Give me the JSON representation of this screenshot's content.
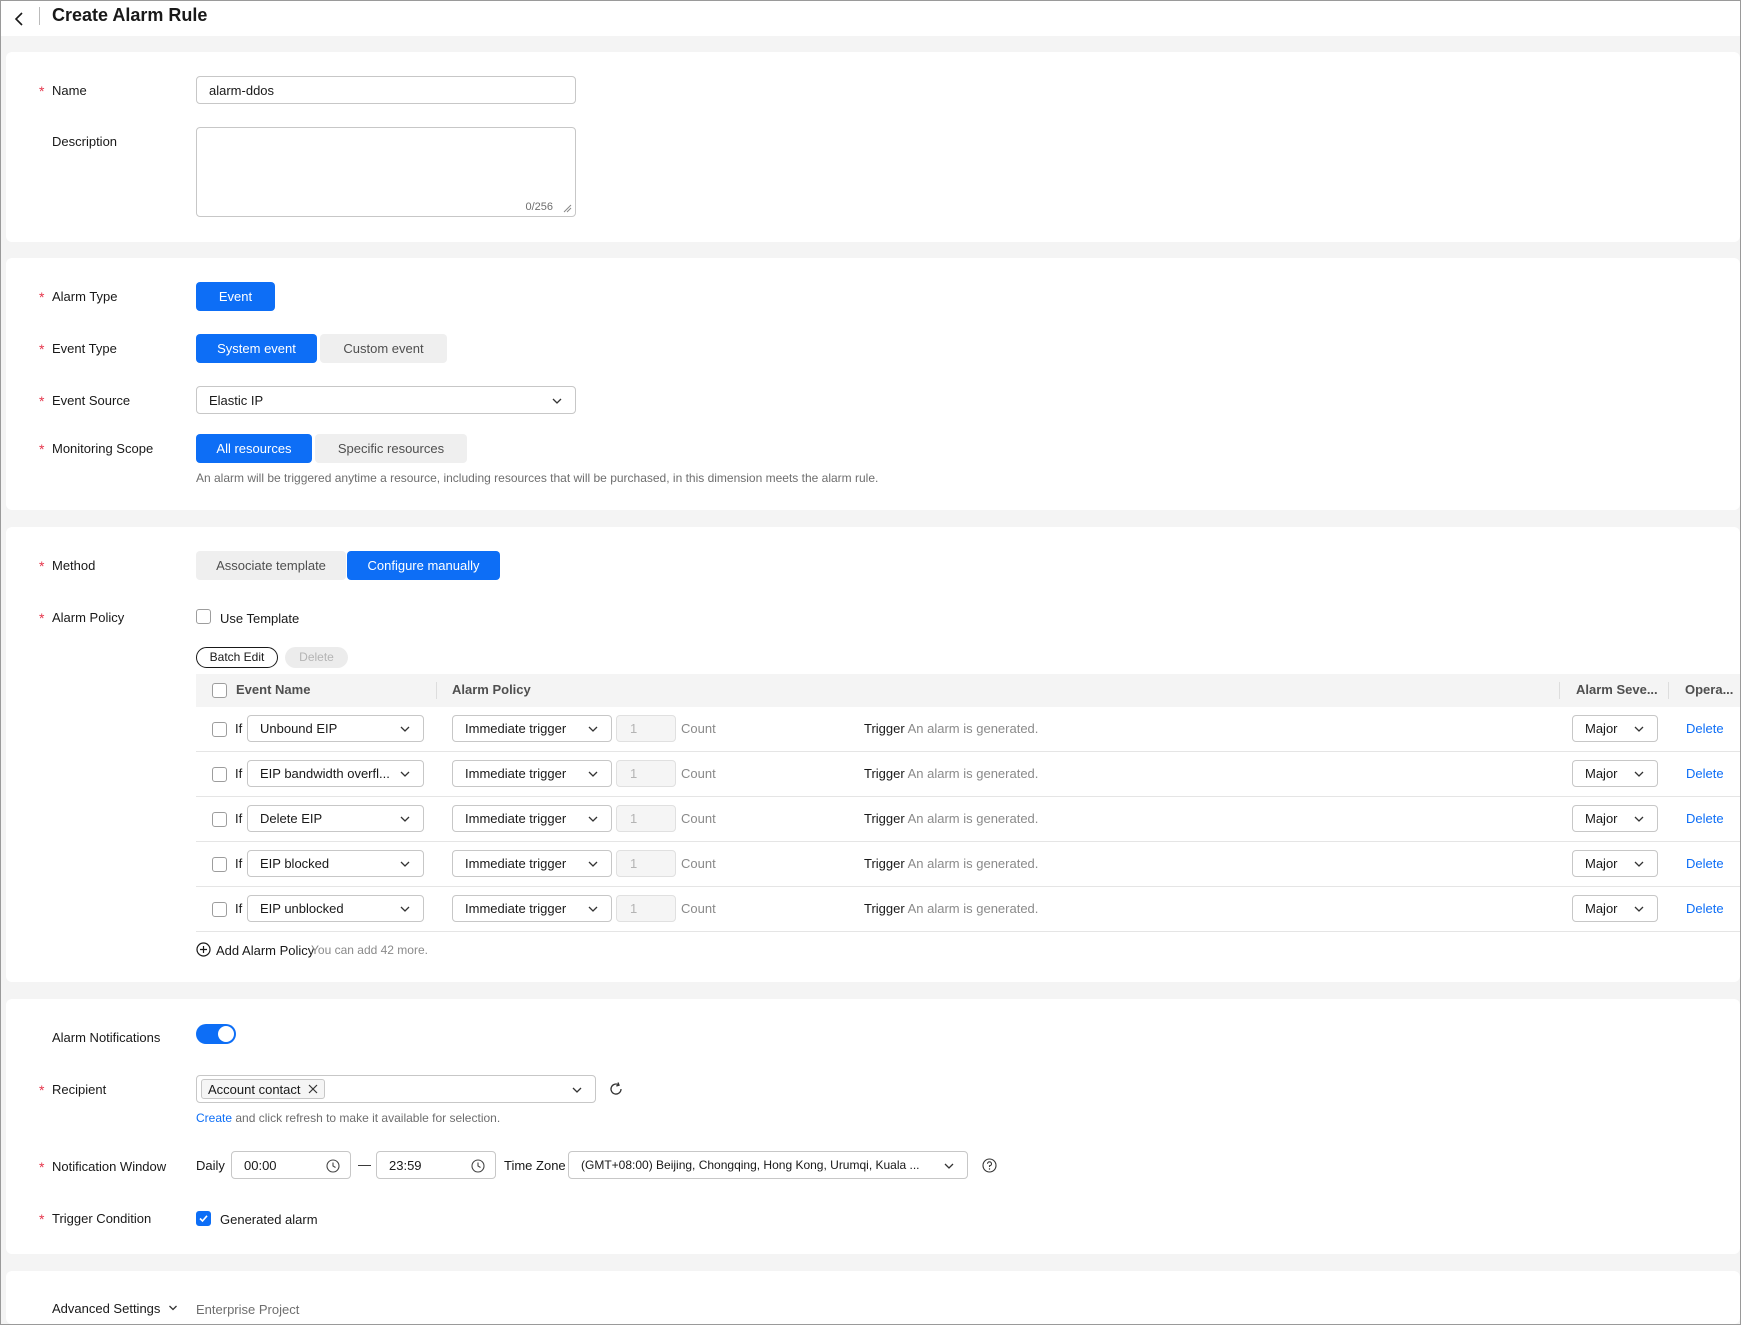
{
  "header": {
    "title": "Create Alarm Rule"
  },
  "basic": {
    "name_label": "Name",
    "name_value": "alarm-ddos",
    "description_label": "Description",
    "description_counter": "0/256"
  },
  "alarm": {
    "alarm_type_label": "Alarm Type",
    "alarm_type_option": "Event",
    "event_type_label": "Event Type",
    "event_type_options": [
      "System event",
      "Custom event"
    ],
    "event_source_label": "Event Source",
    "event_source_value": "Elastic IP",
    "scope_label": "Monitoring Scope",
    "scope_options": [
      "All resources",
      "Specific resources"
    ],
    "scope_hint": "An alarm will be triggered anytime a resource, including resources that will be purchased, in this dimension meets the alarm rule."
  },
  "policy": {
    "method_label": "Method",
    "method_options": [
      "Associate template",
      "Configure manually"
    ],
    "alarm_policy_label": "Alarm Policy",
    "use_template_label": "Use Template",
    "batch_edit_label": "Batch Edit",
    "delete_label": "Delete",
    "columns": [
      "Event Name",
      "Alarm Policy",
      "Alarm Seve...",
      "Opera..."
    ],
    "rows": [
      {
        "if": "If",
        "event": "Unbound EIP",
        "trigger": "Immediate trigger",
        "count": "1",
        "count_label": "Count",
        "trigger_word": "Trigger",
        "trigger_text": "An alarm is generated.",
        "severity": "Major",
        "action": "Delete"
      },
      {
        "if": "If",
        "event": "EIP bandwidth overfl...",
        "trigger": "Immediate trigger",
        "count": "1",
        "count_label": "Count",
        "trigger_word": "Trigger",
        "trigger_text": "An alarm is generated.",
        "severity": "Major",
        "action": "Delete"
      },
      {
        "if": "If",
        "event": "Delete EIP",
        "trigger": "Immediate trigger",
        "count": "1",
        "count_label": "Count",
        "trigger_word": "Trigger",
        "trigger_text": "An alarm is generated.",
        "severity": "Major",
        "action": "Delete"
      },
      {
        "if": "If",
        "event": "EIP blocked",
        "trigger": "Immediate trigger",
        "count": "1",
        "count_label": "Count",
        "trigger_word": "Trigger",
        "trigger_text": "An alarm is generated.",
        "severity": "Major",
        "action": "Delete"
      },
      {
        "if": "If",
        "event": "EIP unblocked",
        "trigger": "Immediate trigger",
        "count": "1",
        "count_label": "Count",
        "trigger_word": "Trigger",
        "trigger_text": "An alarm is generated.",
        "severity": "Major",
        "action": "Delete"
      }
    ],
    "add_policy_label": "Add Alarm Policy",
    "add_policy_hint": "You can add 42 more."
  },
  "notify": {
    "notifications_label": "Alarm Notifications",
    "notifications_on": true,
    "recipient_label": "Recipient",
    "recipient_tag": "Account contact",
    "create_link": "Create",
    "create_hint": "and click refresh to make it available for selection.",
    "window_label": "Notification Window",
    "daily_label": "Daily",
    "start_time": "00:00",
    "dash": "—",
    "end_time": "23:59",
    "timezone_label": "Time Zone",
    "timezone_value": "(GMT+08:00) Beijing, Chongqing, Hong Kong, Urumqi, Kuala ...",
    "trigger_condition_label": "Trigger Condition",
    "generated_alarm_label": "Generated alarm"
  },
  "advanced": {
    "label": "Advanced Settings",
    "enterprise_project_label": "Enterprise Project"
  },
  "colors": {
    "primary": "#0d6ef6",
    "required": "#e5354b",
    "page_bg": "#f4f4f4"
  }
}
